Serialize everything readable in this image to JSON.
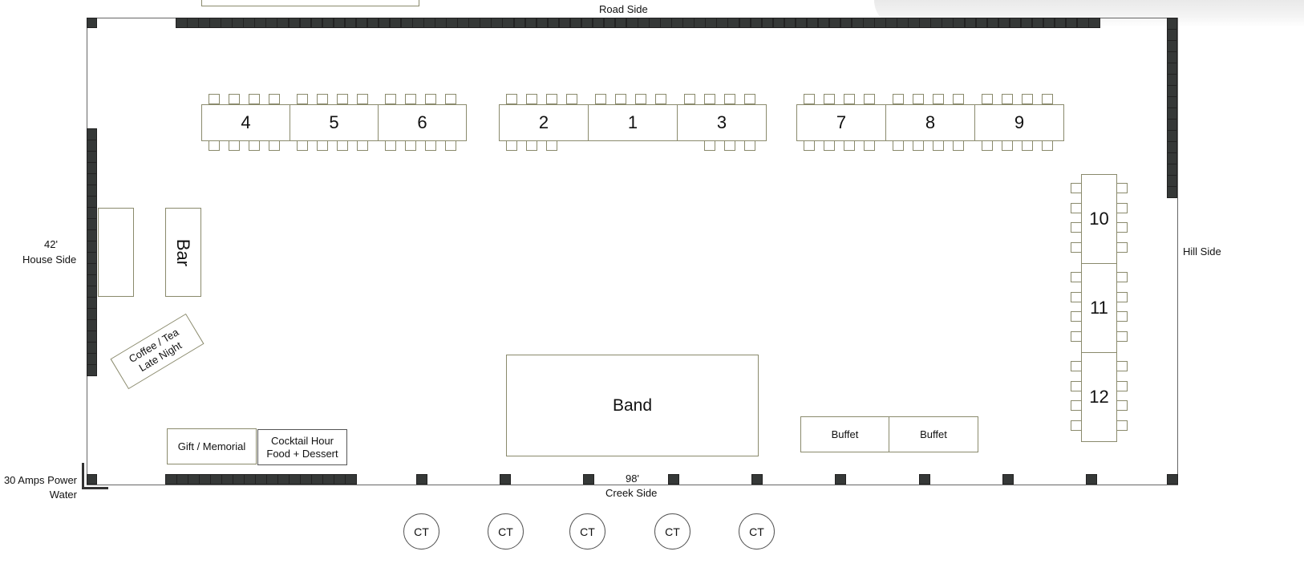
{
  "labels": {
    "road_side": "Road Side",
    "house_width": "42'",
    "house_side": "House Side",
    "hill_side": "Hill Side",
    "creek_length": "98'",
    "creek_side": "Creek Side",
    "power": "30 Amps Power",
    "water": "Water"
  },
  "tables": {
    "t1": "1",
    "t2": "2",
    "t3": "3",
    "t4": "4",
    "t5": "5",
    "t6": "6",
    "t7": "7",
    "t8": "8",
    "t9": "9",
    "t10": "10",
    "t11": "11",
    "t12": "12"
  },
  "stations": {
    "bar": "Bar",
    "coffee_line1": "Coffee / Tea",
    "coffee_line2": "Late Night",
    "gift": "Gift / Memorial",
    "cocktail_line1": "Cocktail Hour",
    "cocktail_line2": "Food + Dessert",
    "band": "Band",
    "buffet1": "Buffet",
    "buffet2": "Buffet"
  },
  "cocktail_tables": [
    "CT",
    "CT",
    "CT",
    "CT",
    "CT"
  ],
  "colors": {
    "wall": "#353837",
    "furniture_outline": "#8a8a6c",
    "outline": "#666666"
  }
}
